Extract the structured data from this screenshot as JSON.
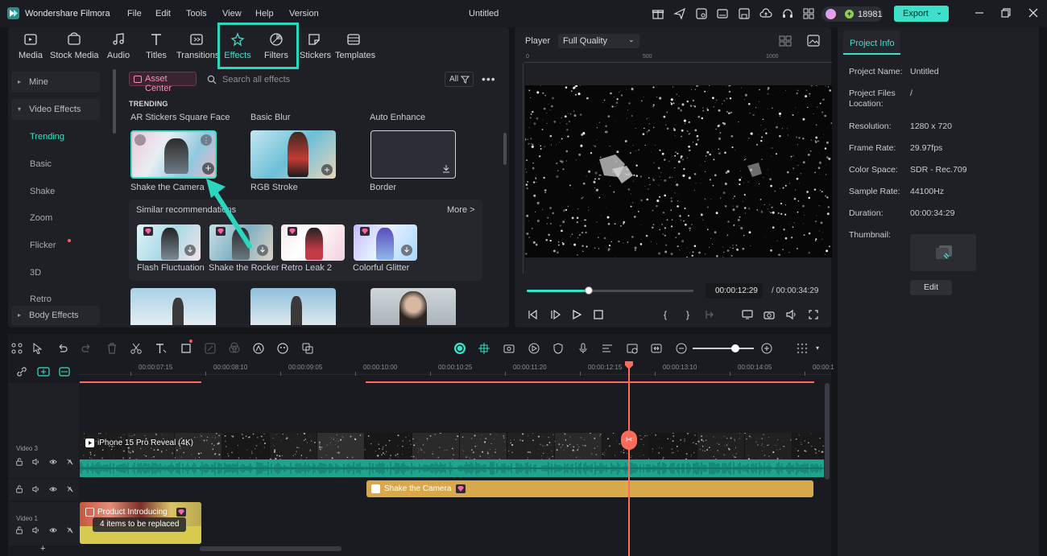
{
  "titlebar": {
    "app_name": "Wondershare Filmora",
    "menus": [
      "File",
      "Edit",
      "Tools",
      "View",
      "Help",
      "Version"
    ],
    "document_title": "Untitled",
    "credits": "18981",
    "export_label": "Export",
    "icons": [
      "gift-icon",
      "send-icon",
      "feedback-icon",
      "layout-icon",
      "save-icon",
      "cloud-upload-icon",
      "headset-icon",
      "grid-icon",
      "minimize-icon",
      "maximize-icon",
      "close-icon"
    ]
  },
  "media_tabs": [
    {
      "label": "Media",
      "icon": "media-icon"
    },
    {
      "label": "Stock Media",
      "icon": "stock-media-icon"
    },
    {
      "label": "Audio",
      "icon": "audio-icon"
    },
    {
      "label": "Titles",
      "icon": "titles-icon"
    },
    {
      "label": "Transitions",
      "icon": "transitions-icon"
    },
    {
      "label": "Effects",
      "icon": "effects-icon",
      "active": true
    },
    {
      "label": "Filters",
      "icon": "filters-icon"
    },
    {
      "label": "Stickers",
      "icon": "stickers-icon"
    },
    {
      "label": "Templates",
      "icon": "templates-icon"
    }
  ],
  "sidebar": {
    "groups": [
      {
        "label": "Mine"
      },
      {
        "label": "Video Effects"
      },
      {
        "label": "Body Effects"
      }
    ],
    "items": [
      "Trending",
      "Basic",
      "Shake",
      "Zoom",
      "Flicker",
      "3D",
      "Retro"
    ],
    "active_item": "Trending"
  },
  "browser": {
    "asset_center": "Asset Center",
    "search_placeholder": "Search all effects",
    "filter_label": "All",
    "section": "TRENDING",
    "trending_titles": [
      "AR Stickers Square Face",
      "Basic Blur",
      "Auto Enhance"
    ],
    "trending_cards": [
      "Shake the Camera",
      "RGB Stroke",
      "Border"
    ],
    "similar_title": "Similar recommendations",
    "similar_more": "More >",
    "similar_cards": [
      "Flash Fluctuation",
      "Shake the Rocker",
      "Retro Leak 2",
      "Colorful Glitter"
    ]
  },
  "player": {
    "label": "Player",
    "quality": "Full Quality",
    "ruler_marks": [
      "0",
      "500",
      "1000"
    ],
    "current_time": "00:00:12:29",
    "total_time": "/ 00:00:34:29",
    "progress": 0.37
  },
  "project_info": {
    "tab": "Project Info",
    "rows": [
      {
        "label": "Project Name:",
        "value": "Untitled"
      },
      {
        "label": "Project Files Location:",
        "value": "/"
      },
      {
        "label": "Resolution:",
        "value": "1280 x 720"
      },
      {
        "label": "Frame Rate:",
        "value": "29.97fps"
      },
      {
        "label": "Color Space:",
        "value": "SDR - Rec.709"
      },
      {
        "label": "Sample Rate:",
        "value": "44100Hz"
      },
      {
        "label": "Duration:",
        "value": "00:00:34:29"
      },
      {
        "label": "Thumbnail:",
        "value": ""
      }
    ],
    "edit_label": "Edit"
  },
  "timeline": {
    "ticks": [
      "00:00:07:15",
      "00:00:08:10",
      "00:00:09:05",
      "00:00:10:00",
      "00:00:10:25",
      "00:00:11:20",
      "00:00:12:15",
      "00:00:13:10",
      "00:00:14:05",
      "00:00:1"
    ],
    "tracks": [
      {
        "label": "Video 3"
      },
      {
        "label": ""
      },
      {
        "label": "Video 1"
      }
    ],
    "video_clip_title": "iPhone 15 Pro Reveal (4K)",
    "effect_clip_title": "Shake the Camera",
    "template_clip_title": "Product Introducing",
    "replace_tag": "4 items to be replaced"
  }
}
